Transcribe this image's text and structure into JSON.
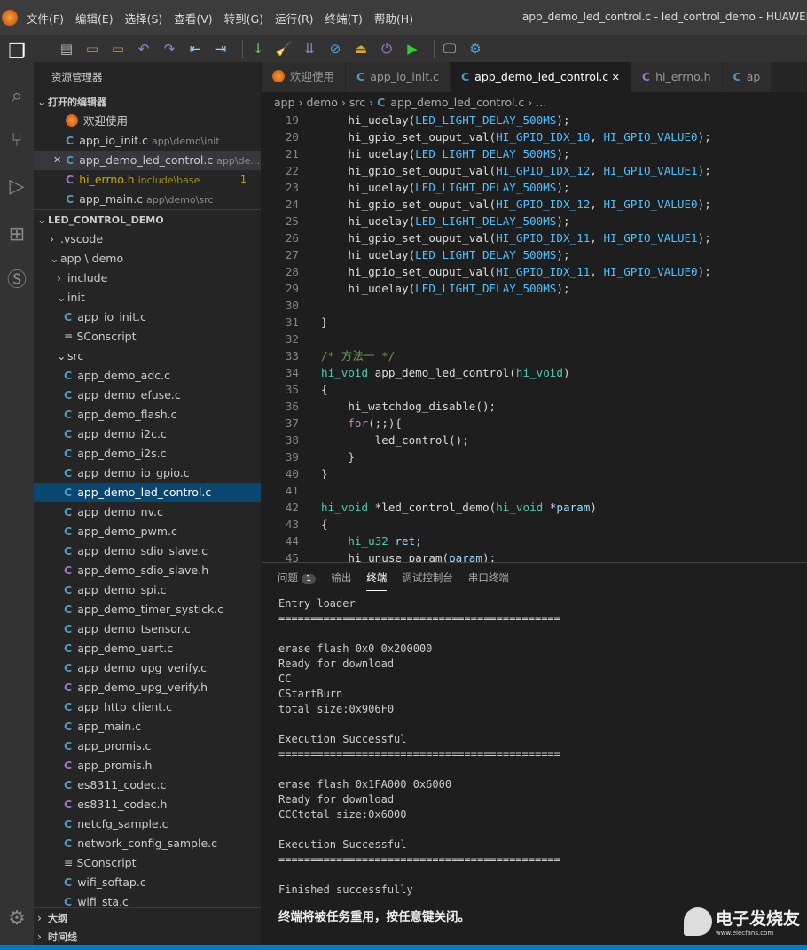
{
  "menu": [
    "文件(F)",
    "编辑(E)",
    "选择(S)",
    "查看(V)",
    "转到(G)",
    "运行(R)",
    "终端(T)",
    "帮助(H)"
  ],
  "window_title": "app_demo_led_control.c - led_control_demo - HUAWEI-LiteO",
  "sidebar": {
    "title": "资源管理器",
    "open_editors_header": "打开的编辑器",
    "open_editors": [
      {
        "name": "欢迎使用",
        "path": "",
        "kind": "welcome"
      },
      {
        "name": "app_io_init.c",
        "path": "app\\demo\\init",
        "kind": "c"
      },
      {
        "name": "app_demo_led_control.c",
        "path": "app\\de...",
        "kind": "c"
      },
      {
        "name": "hi_errno.h",
        "path": "include\\base",
        "kind": "h",
        "badge": "1"
      },
      {
        "name": "app_main.c",
        "path": "app\\demo\\src",
        "kind": "c"
      }
    ],
    "project_header": "LED_CONTROL_DEMO",
    "tree": [
      {
        "name": ".vscode",
        "kind": "folder-closed",
        "depth": 1
      },
      {
        "name": "app \\ demo",
        "kind": "folder-open",
        "depth": 1
      },
      {
        "name": "include",
        "kind": "folder-closed",
        "depth": 2
      },
      {
        "name": "init",
        "kind": "folder-open",
        "depth": 2
      },
      {
        "name": "app_io_init.c",
        "kind": "c",
        "depth": 3
      },
      {
        "name": "SConscript",
        "kind": "text",
        "depth": 3
      },
      {
        "name": "src",
        "kind": "folder-open",
        "depth": 2
      },
      {
        "name": "app_demo_adc.c",
        "kind": "c",
        "depth": 3
      },
      {
        "name": "app_demo_efuse.c",
        "kind": "c",
        "depth": 3
      },
      {
        "name": "app_demo_flash.c",
        "kind": "c",
        "depth": 3
      },
      {
        "name": "app_demo_i2c.c",
        "kind": "c",
        "depth": 3
      },
      {
        "name": "app_demo_i2s.c",
        "kind": "c",
        "depth": 3
      },
      {
        "name": "app_demo_io_gpio.c",
        "kind": "c",
        "depth": 3
      },
      {
        "name": "app_demo_led_control.c",
        "kind": "c",
        "depth": 3,
        "selected": true
      },
      {
        "name": "app_demo_nv.c",
        "kind": "c",
        "depth": 3
      },
      {
        "name": "app_demo_pwm.c",
        "kind": "c",
        "depth": 3
      },
      {
        "name": "app_demo_sdio_slave.c",
        "kind": "c",
        "depth": 3
      },
      {
        "name": "app_demo_sdio_slave.h",
        "kind": "h",
        "depth": 3
      },
      {
        "name": "app_demo_spi.c",
        "kind": "c",
        "depth": 3
      },
      {
        "name": "app_demo_timer_systick.c",
        "kind": "c",
        "depth": 3
      },
      {
        "name": "app_demo_tsensor.c",
        "kind": "c",
        "depth": 3
      },
      {
        "name": "app_demo_uart.c",
        "kind": "c",
        "depth": 3
      },
      {
        "name": "app_demo_upg_verify.c",
        "kind": "c",
        "depth": 3
      },
      {
        "name": "app_demo_upg_verify.h",
        "kind": "h",
        "depth": 3
      },
      {
        "name": "app_http_client.c",
        "kind": "c",
        "depth": 3
      },
      {
        "name": "app_main.c",
        "kind": "c",
        "depth": 3
      },
      {
        "name": "app_promis.c",
        "kind": "c",
        "depth": 3
      },
      {
        "name": "app_promis.h",
        "kind": "h",
        "depth": 3
      },
      {
        "name": "es8311_codec.c",
        "kind": "c",
        "depth": 3
      },
      {
        "name": "es8311_codec.h",
        "kind": "h",
        "depth": 3
      },
      {
        "name": "netcfg_sample.c",
        "kind": "c",
        "depth": 3
      },
      {
        "name": "network_config_sample.c",
        "kind": "c",
        "depth": 3
      },
      {
        "name": "SConscript",
        "kind": "text",
        "depth": 3
      },
      {
        "name": "wifi_softap.c",
        "kind": "c",
        "depth": 3
      },
      {
        "name": "wifi_sta.c",
        "kind": "c",
        "depth": 3
      }
    ],
    "outline": "大纲",
    "timeline": "时间线"
  },
  "tabs": [
    {
      "label": "欢迎使用",
      "kind": "welcome"
    },
    {
      "label": "app_io_init.c",
      "kind": "c"
    },
    {
      "label": "app_demo_led_control.c",
      "kind": "c",
      "active": true
    },
    {
      "label": "hi_errno.h",
      "kind": "h"
    },
    {
      "label": "ap",
      "kind": "c"
    }
  ],
  "breadcrumb": [
    "app",
    "demo",
    "src",
    "app_demo_led_control.c",
    "..."
  ],
  "code": [
    [
      19,
      [
        [
          "    hi_udelay(",
          "f"
        ],
        [
          "LED_LIGHT_DELAY_500MS",
          "c"
        ],
        [
          ");",
          "p"
        ]
      ]
    ],
    [
      20,
      [
        [
          "    hi_gpio_set_ouput_val(",
          "f"
        ],
        [
          "HI_GPIO_IDX_10",
          "c"
        ],
        [
          ", ",
          "p"
        ],
        [
          "HI_GPIO_VALUE0",
          "c"
        ],
        [
          ");",
          "p"
        ]
      ]
    ],
    [
      21,
      [
        [
          "    hi_udelay(",
          "f"
        ],
        [
          "LED_LIGHT_DELAY_500MS",
          "c"
        ],
        [
          ");",
          "p"
        ]
      ]
    ],
    [
      22,
      [
        [
          "    hi_gpio_set_ouput_val(",
          "f"
        ],
        [
          "HI_GPIO_IDX_12",
          "c"
        ],
        [
          ", ",
          "p"
        ],
        [
          "HI_GPIO_VALUE1",
          "c"
        ],
        [
          ");",
          "p"
        ]
      ]
    ],
    [
      23,
      [
        [
          "    hi_udelay(",
          "f"
        ],
        [
          "LED_LIGHT_DELAY_500MS",
          "c"
        ],
        [
          ");",
          "p"
        ]
      ]
    ],
    [
      24,
      [
        [
          "    hi_gpio_set_ouput_val(",
          "f"
        ],
        [
          "HI_GPIO_IDX_12",
          "c"
        ],
        [
          ", ",
          "p"
        ],
        [
          "HI_GPIO_VALUE0",
          "c"
        ],
        [
          ");",
          "p"
        ]
      ]
    ],
    [
      25,
      [
        [
          "    hi_udelay(",
          "f"
        ],
        [
          "LED_LIGHT_DELAY_500MS",
          "c"
        ],
        [
          ");",
          "p"
        ]
      ]
    ],
    [
      26,
      [
        [
          "    hi_gpio_set_ouput_val(",
          "f"
        ],
        [
          "HI_GPIO_IDX_11",
          "c"
        ],
        [
          ", ",
          "p"
        ],
        [
          "HI_GPIO_VALUE1",
          "c"
        ],
        [
          ");",
          "p"
        ]
      ]
    ],
    [
      27,
      [
        [
          "    hi_udelay(",
          "f"
        ],
        [
          "LED_LIGHT_DELAY_500MS",
          "c"
        ],
        [
          ");",
          "p"
        ]
      ]
    ],
    [
      28,
      [
        [
          "    hi_gpio_set_ouput_val(",
          "f"
        ],
        [
          "HI_GPIO_IDX_11",
          "c"
        ],
        [
          ", ",
          "p"
        ],
        [
          "HI_GPIO_VALUE0",
          "c"
        ],
        [
          ");",
          "p"
        ]
      ]
    ],
    [
      29,
      [
        [
          "    hi_udelay(",
          "f"
        ],
        [
          "LED_LIGHT_DELAY_500MS",
          "c"
        ],
        [
          ");",
          "p"
        ]
      ]
    ],
    [
      30,
      []
    ],
    [
      31,
      [
        [
          "}",
          "p"
        ]
      ]
    ],
    [
      32,
      []
    ],
    [
      33,
      [
        [
          "/* 方法一 */",
          "m"
        ]
      ]
    ],
    [
      34,
      [
        [
          "hi_void",
          "t"
        ],
        [
          " app_demo_led_control(",
          "f"
        ],
        [
          "hi_void",
          "t"
        ],
        [
          ")",
          "p"
        ]
      ]
    ],
    [
      35,
      [
        [
          "{",
          "p"
        ]
      ]
    ],
    [
      36,
      [
        [
          "    hi_watchdog_disable();",
          "f"
        ]
      ]
    ],
    [
      37,
      [
        [
          "    ",
          "p"
        ],
        [
          "for",
          "k"
        ],
        [
          "(;;){",
          "p"
        ]
      ]
    ],
    [
      38,
      [
        [
          "        led_control();",
          "f"
        ]
      ]
    ],
    [
      39,
      [
        [
          "    }",
          "p"
        ]
      ]
    ],
    [
      40,
      [
        [
          "}",
          "p"
        ]
      ]
    ],
    [
      41,
      []
    ],
    [
      42,
      [
        [
          "hi_void",
          "t"
        ],
        [
          " *",
          "p"
        ],
        [
          "led_control_demo(",
          "f"
        ],
        [
          "hi_void",
          "t"
        ],
        [
          " *",
          "p"
        ],
        [
          "param",
          "v"
        ],
        [
          ")",
          "p"
        ]
      ]
    ],
    [
      43,
      [
        [
          "{",
          "p"
        ]
      ]
    ],
    [
      44,
      [
        [
          "    ",
          "p"
        ],
        [
          "hi_u32",
          "t"
        ],
        [
          " ret;",
          "v"
        ]
      ]
    ],
    [
      45,
      [
        [
          "    hi_unuse_param(",
          "f"
        ],
        [
          "param",
          "v"
        ],
        [
          ");",
          "p"
        ]
      ]
    ]
  ],
  "panel": {
    "tabs": [
      {
        "label": "问题",
        "badge": "1"
      },
      {
        "label": "输出"
      },
      {
        "label": "终端",
        "active": true
      },
      {
        "label": "调试控制台"
      },
      {
        "label": "串口终端"
      }
    ],
    "terminal": [
      "Entry loader",
      "============================================",
      "",
      "erase flash 0x0 0x200000",
      "Ready for download",
      "CC",
      "CStartBurn",
      "total size:0x906F0",
      "",
      "Execution Successful",
      "============================================",
      "",
      "erase flash 0x1FA000 0x6000",
      "Ready for download",
      "CCCtotal size:0x6000",
      "",
      "Execution Successful",
      "============================================",
      "",
      "Finished successfully"
    ],
    "terminal_notice": "终端将被任务重用，按任意键关闭。"
  },
  "watermark": {
    "name": "电子发烧友",
    "url": "www.elecfans.com"
  },
  "colors": {
    "accent": "#007acc",
    "selection": "#094771"
  }
}
